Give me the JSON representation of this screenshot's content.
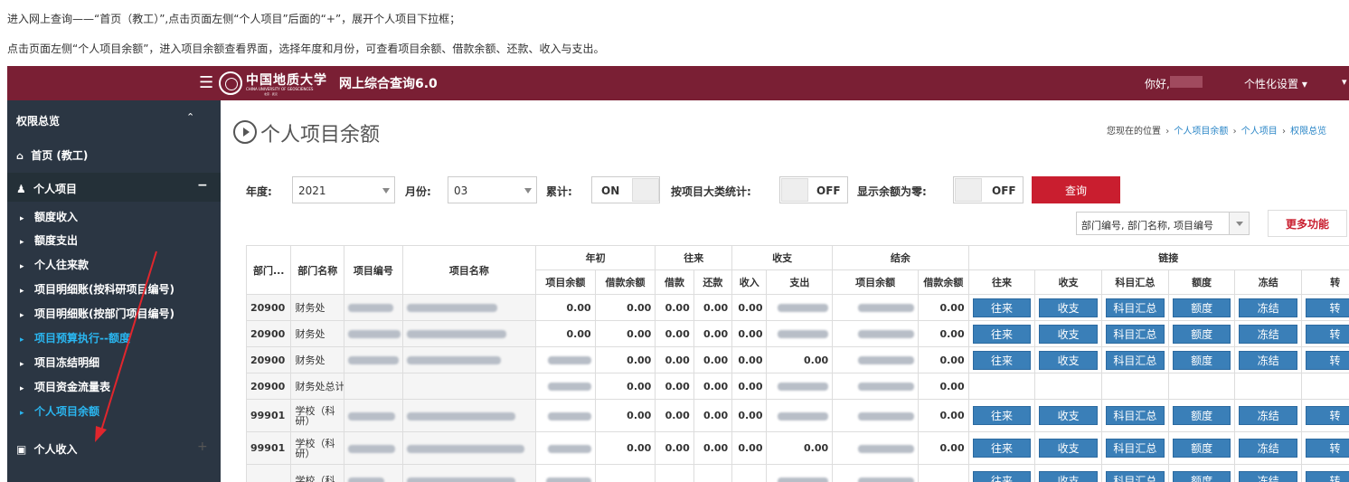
{
  "instructions": {
    "line1": "进入网上查询——“首页（教工）”,点击页面左侧“个人项目”后面的“+”，展开个人项目下拉框；",
    "line2": "点击页面左侧“个人项目余额”，进入项目余额查看界面，选择年度和月份，可查看项目余额、借款余额、还款、收入与支出。"
  },
  "header": {
    "menu_icon": "☰",
    "university_cn": "中国地质大学",
    "university_en": "CHINA UNIVERSITY OF GEOSCIENCES",
    "university_sub": "北京 · 武汉",
    "system_title": "网上综合查询6.0",
    "greeting": "你好,",
    "settings_label": "个性化设置 ▾",
    "edge_icon": "▾"
  },
  "sidebar": {
    "section_title": "权限总览",
    "section_chevron": "⌃",
    "home_icon": "⌂",
    "home_label": "首页 (教工)",
    "project_icon": "♟",
    "project_label": "个人项目",
    "project_toggle": "−",
    "items": [
      {
        "label": "额度收入"
      },
      {
        "label": "额度支出"
      },
      {
        "label": "个人往来款"
      },
      {
        "label": "项目明细账(按科研项目编号)"
      },
      {
        "label": "项目明细账(按部门项目编号)"
      },
      {
        "label": "项目预算执行--额度"
      },
      {
        "label": "项目冻结明细"
      },
      {
        "label": "项目资金流量表"
      },
      {
        "label": "个人项目余额"
      }
    ],
    "item_marker": "▸",
    "income_icon": "▣",
    "income_label": "个人收入",
    "income_toggle": "+"
  },
  "main": {
    "page_title": "个人项目余额",
    "breadcrumb": {
      "prefix": "您现在的位置",
      "sep": "›",
      "items": [
        "个人项目余额",
        "个人项目",
        "权限总览"
      ]
    },
    "filters": {
      "year_label": "年度:",
      "year_value": "2021",
      "month_label": "月份:",
      "month_value": "03",
      "cumulative_label": "累计:",
      "cumulative_state": "ON",
      "by_category_label": "按项目大类统计:",
      "by_category_state": "OFF",
      "show_zero_label": "显示余额为零:",
      "show_zero_state": "OFF",
      "query_button": "查询"
    },
    "order_select": "部门编号, 部门名称, 项目编号",
    "more_button": "更多功能"
  },
  "table": {
    "group_headers": {
      "dept_code": "部门...",
      "dept_name": "部门名称",
      "proj_code": "项目编号",
      "proj_name": "项目名称",
      "year_start": "年初",
      "transfer": "往来",
      "income_expense": "收支",
      "balance": "结余",
      "links": "链接"
    },
    "sub_headers": {
      "ys_proj_balance": "项目余额",
      "ys_loan_balance": "借款余额",
      "loan": "借款",
      "repay": "还款",
      "income": "收入",
      "expense": "支出",
      "bal_proj_balance": "项目余额",
      "bal_loan_balance": "借款余额",
      "l_transfer": "往来",
      "l_ie": "收支",
      "l_subject": "科目汇总",
      "l_quota": "额度",
      "l_freeze": "冻结",
      "l_turn": "转"
    },
    "buttons": {
      "transfer": "往来",
      "ie": "收支",
      "subject": "科目汇总",
      "quota": "额度",
      "freeze": "冻结",
      "turn": "转"
    },
    "rows": [
      {
        "code": "20900",
        "dept": "财务处",
        "ys_pb": "0.00",
        "ys_lb": "0.00",
        "loan": "0.00",
        "repay": "0.00",
        "income": "0.00",
        "expense": "",
        "bal_pb": "",
        "bal_lb": "0.00",
        "links": true
      },
      {
        "code": "20900",
        "dept": "财务处",
        "ys_pb": "0.00",
        "ys_lb": "0.00",
        "loan": "0.00",
        "repay": "0.00",
        "income": "0.00",
        "expense": "",
        "bal_pb": "",
        "bal_lb": "0.00",
        "links": true
      },
      {
        "code": "20900",
        "dept": "财务处",
        "ys_pb": "",
        "ys_lb": "0.00",
        "loan": "0.00",
        "repay": "0.00",
        "income": "0.00",
        "expense": "0.00",
        "bal_pb": "",
        "bal_lb": "0.00",
        "links": true
      },
      {
        "code": "20900",
        "dept": "财务处总计",
        "ys_pb": "",
        "ys_lb": "0.00",
        "loan": "0.00",
        "repay": "0.00",
        "income": "0.00",
        "expense": "",
        "bal_pb": "",
        "bal_lb": "0.00",
        "links": false
      },
      {
        "code": "99901",
        "dept": "学校（科研）",
        "ys_pb": "",
        "ys_lb": "0.00",
        "loan": "0.00",
        "repay": "0.00",
        "income": "0.00",
        "expense": "",
        "bal_pb": "",
        "bal_lb": "0.00",
        "links": true
      },
      {
        "code": "99901",
        "dept": "学校（科研）",
        "ys_pb": "",
        "ys_lb": "0.00",
        "loan": "0.00",
        "repay": "0.00",
        "income": "0.00",
        "expense": "0.00",
        "bal_pb": "",
        "bal_lb": "0.00",
        "links": true
      },
      {
        "code": "",
        "dept": "学校（科",
        "ys_pb": "",
        "ys_lb": "",
        "loan": "",
        "repay": "",
        "income": "",
        "expense": "",
        "bal_pb": "",
        "bal_lb": "",
        "links": true
      }
    ]
  },
  "colors": {
    "header_bg": "#7a1f34",
    "sidebar_bg": "#2b3643",
    "active_item": "#2ab6f0",
    "accent_red": "#c91e2f",
    "link_button": "#3a7fb8",
    "annotation_arrow": "#e0262d"
  }
}
